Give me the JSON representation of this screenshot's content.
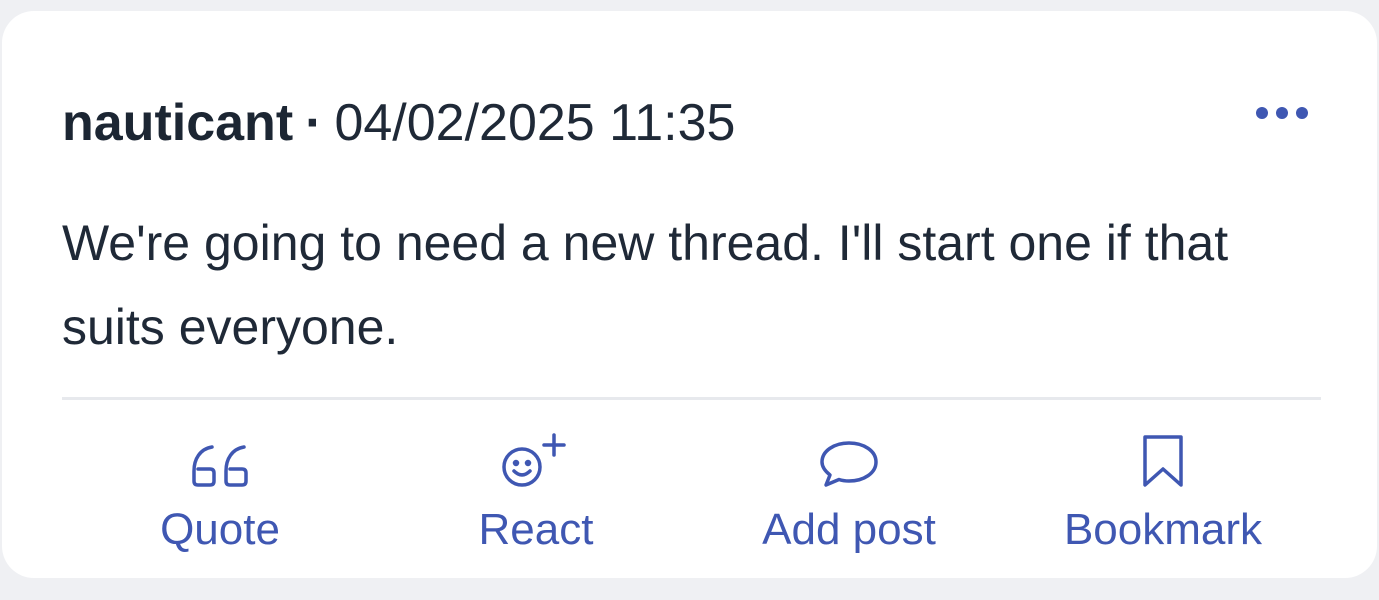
{
  "post": {
    "author": "nauticant",
    "separator": "·",
    "timestamp": "04/02/2025 11:35",
    "more_icon": "ellipsis-icon",
    "body": "We're going to need a new thread. I'll start one if that suits everyone."
  },
  "actions": [
    {
      "label": "Quote",
      "icon": "quote-icon"
    },
    {
      "label": "React",
      "icon": "react-smiley-icon"
    },
    {
      "label": "Add post",
      "icon": "speech-bubble-icon"
    },
    {
      "label": "Bookmark",
      "icon": "bookmark-icon"
    }
  ],
  "colors": {
    "accent": "#3f57b2",
    "text": "#1f2937",
    "background": "#eff0f3",
    "card": "#ffffff",
    "divider": "#e7e9ed"
  }
}
